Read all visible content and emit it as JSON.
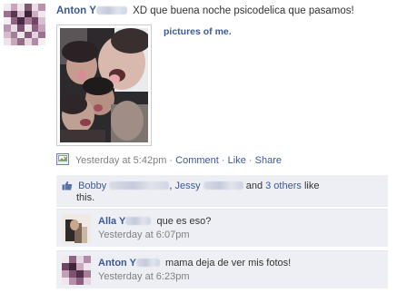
{
  "post": {
    "author_first": "Anton",
    "author_initial": "Y",
    "message": "XD que buena noche psicodelica que pasamos!",
    "album_label": "pictures of me.",
    "timestamp": "Yesterday at 5:42pm",
    "sep": "·",
    "actions": {
      "comment": "Comment",
      "like": "Like",
      "share": "Share"
    }
  },
  "likes": {
    "first": "Bobby",
    "comma": ",",
    "second": "Jessy",
    "and_text": "and",
    "others_link": "3 others",
    "tail": "like",
    "tail2": "this."
  },
  "comments": [
    {
      "author_first": "Alla",
      "author_initial": "Y",
      "text": "que es eso?",
      "timestamp": "Yesterday at 6:07pm"
    },
    {
      "author_first": "Anton",
      "author_initial": "Y",
      "text": "mama deja de ver mis fotos!",
      "timestamp": "Yesterday at 6:23pm"
    }
  ],
  "colors": {
    "link": "#3b5998",
    "meta": "#808080",
    "ufi_bg": "#edeff4"
  }
}
